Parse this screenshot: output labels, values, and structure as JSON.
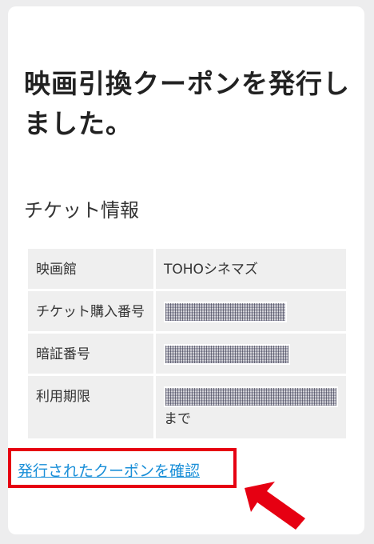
{
  "page": {
    "title": "映画引換クーポンを発行しました。",
    "section_title": "チケット情報"
  },
  "ticket_info": {
    "rows": [
      {
        "label": "映画館",
        "value": "TOHOシネマズ"
      },
      {
        "label": "チケット購入番号",
        "value": ""
      },
      {
        "label": "暗証番号",
        "value": ""
      },
      {
        "label": "利用期限",
        "value": "",
        "suffix": "まで"
      }
    ]
  },
  "link": {
    "label": "発行されたクーポンを確認"
  },
  "colors": {
    "highlight_border": "#e60012",
    "link": "#1a8fd8",
    "arrow": "#e60012"
  },
  "icons": {
    "arrow": "red-arrow-icon"
  }
}
